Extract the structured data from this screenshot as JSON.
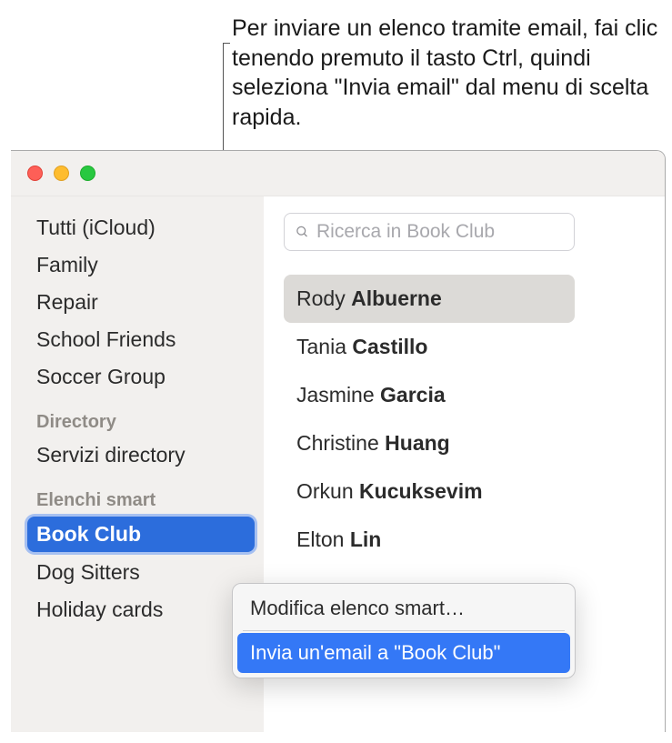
{
  "annotation": "Per inviare un elenco tramite email, fai clic tenendo premuto il tasto Ctrl, quindi seleziona \"Invia email\" dal menu di scelta rapida.",
  "sidebar": {
    "groups": [
      {
        "header": null,
        "items": [
          {
            "label": "Tutti (iCloud)",
            "selected": false
          },
          {
            "label": "Family",
            "selected": false
          },
          {
            "label": "Repair",
            "selected": false
          },
          {
            "label": "School Friends",
            "selected": false
          },
          {
            "label": "Soccer Group",
            "selected": false
          }
        ]
      },
      {
        "header": "Directory",
        "items": [
          {
            "label": "Servizi directory",
            "selected": false
          }
        ]
      },
      {
        "header": "Elenchi smart",
        "items": [
          {
            "label": "Book Club",
            "selected": true
          },
          {
            "label": "Dog Sitters",
            "selected": false
          },
          {
            "label": "Holiday cards",
            "selected": false
          }
        ]
      }
    ]
  },
  "search": {
    "placeholder": "Ricerca in Book Club"
  },
  "contacts": [
    {
      "first": "Rody",
      "last": "Albuerne",
      "selected": true
    },
    {
      "first": "Tania",
      "last": "Castillo",
      "selected": false
    },
    {
      "first": "Jasmine",
      "last": "Garcia",
      "selected": false
    },
    {
      "first": "Christine",
      "last": "Huang",
      "selected": false
    },
    {
      "first": "Orkun",
      "last": "Kucuksevim",
      "selected": false
    },
    {
      "first": "Elton",
      "last": "Lin",
      "selected": false
    }
  ],
  "context_menu": {
    "items": [
      {
        "label": "Modifica elenco smart…",
        "highlighted": false
      },
      {
        "label": "Invia un'email a \"Book Club\"",
        "highlighted": true
      }
    ]
  }
}
